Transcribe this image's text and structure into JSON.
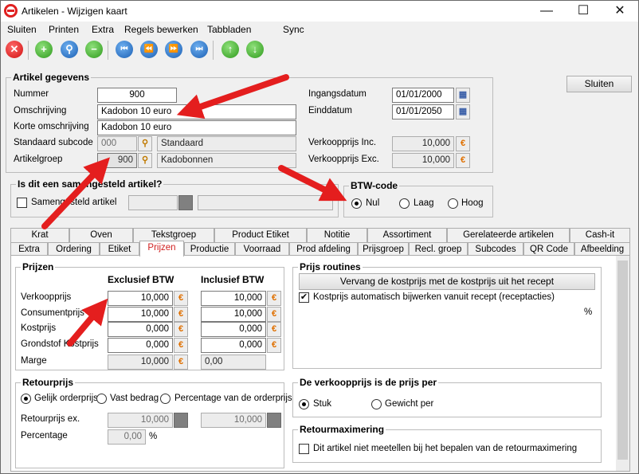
{
  "window": {
    "title": "Artikelen - Wijzigen kaart",
    "min_glyph": "—",
    "max_glyph": "☐",
    "close_glyph": "✕"
  },
  "menu": [
    {
      "label": "Sluiten"
    },
    {
      "label": "Printen"
    },
    {
      "label": "Extra"
    },
    {
      "label": "Regels bewerken"
    },
    {
      "label": "Tabbladen"
    },
    {
      "label": "Sync"
    }
  ],
  "toolbar": {
    "close_icon": "✕",
    "add_icon": "+",
    "search_icon": "⚲",
    "remove_icon": "−",
    "first_icon": "⏮",
    "prev_icon": "⏪",
    "next_icon": "⏩",
    "last_icon": "⏭",
    "up_icon": "↑",
    "down_icon": "↓"
  },
  "close_button": "Sluiten",
  "artikel": {
    "title": "Artikel gegevens",
    "nummer_label": "Nummer",
    "nummer": "900",
    "omschrijving_label": "Omschrijving",
    "omschrijving": "Kadobon 10 euro",
    "korte_label": "Korte omschrijving",
    "korte": "Kadobon 10 euro",
    "subcode_label": "Standaard subcode",
    "subcode": "000",
    "subcode_name": "Standaard",
    "groep_label": "Artikelgroep",
    "groep": "900",
    "groep_name": "Kadobonnen",
    "ingang_label": "Ingangsdatum",
    "ingang": "01/01/2000",
    "eind_label": "Einddatum",
    "eind": "01/01/2050",
    "vk_inc_label": "Verkoopprijs Inc.",
    "vk_inc": "10,000",
    "vk_exc_label": "Verkoopprijs Exc.",
    "vk_exc": "10,000"
  },
  "samengesteld": {
    "title": "Is dit een samengesteld artikel?",
    "check_label": "Samengesteld artikel"
  },
  "btw": {
    "title": "BTW-code",
    "options": [
      "Nul",
      "Laag",
      "Hoog"
    ],
    "selected": "Nul"
  },
  "tabs_row1": [
    "Krat",
    "Oven",
    "Tekstgroep",
    "Product Etiket",
    "Notitie",
    "Assortiment",
    "Gerelateerde artikelen",
    "Cash-it"
  ],
  "tabs_row2": [
    "Extra",
    "Ordering",
    "Etiket",
    "Prijzen",
    "Productie",
    "Voorraad",
    "Prod afdeling",
    "Prijsgroep",
    "Recl. groep",
    "Subcodes",
    "QR Code",
    "Afbeelding"
  ],
  "active_tab": "Prijzen",
  "prijzen": {
    "title": "Prijzen",
    "col_excl": "Exclusief BTW",
    "col_incl": "Inclusief BTW",
    "rows": [
      {
        "label": "Verkoopprijs",
        "excl": "10,000",
        "incl": "10,000"
      },
      {
        "label": "Consumentprijs",
        "excl": "10,000",
        "incl": "10,000"
      },
      {
        "label": "Kostprijs",
        "excl": "0,000",
        "incl": "0,000"
      },
      {
        "label": "Grondstof Kostprijs",
        "excl": "0,000",
        "incl": "0,000"
      },
      {
        "label": "Marge",
        "excl": "10,000",
        "incl": "0,00"
      }
    ]
  },
  "prijs_routines": {
    "title": "Prijs routines",
    "button": "Vervang de kostprijs met de kostprijs uit het recept",
    "check_label": "Kostprijs automatisch bijwerken vanuit recept (receptacties)",
    "percent": "%"
  },
  "retourprijs": {
    "title": "Retourprijs",
    "options": [
      "Gelijk orderprijs",
      "Vast bedrag",
      "Percentage van de orderprijs"
    ],
    "selected": "Gelijk orderprijs",
    "ex_label": "Retourprijs ex.",
    "ex_value": "10,000",
    "inc_value": "10,000",
    "pct_label": "Percentage",
    "pct_value": "0,00",
    "pct_unit": "%"
  },
  "prijs_per": {
    "title": "De verkoopprijs is de prijs per",
    "options": [
      "Stuk",
      "Gewicht per"
    ],
    "selected": "Stuk"
  },
  "retourmax": {
    "title": "Retourmaximering",
    "check_label": "Dit artikel niet meetellen bij het bepalen van de retourmaximering"
  },
  "icons": {
    "euro": "€",
    "search": "⚲",
    "calendar": "▦",
    "check": "✔"
  },
  "colors": {
    "accent_red": "#e41e1e",
    "active_tab_text": "#d02020"
  }
}
